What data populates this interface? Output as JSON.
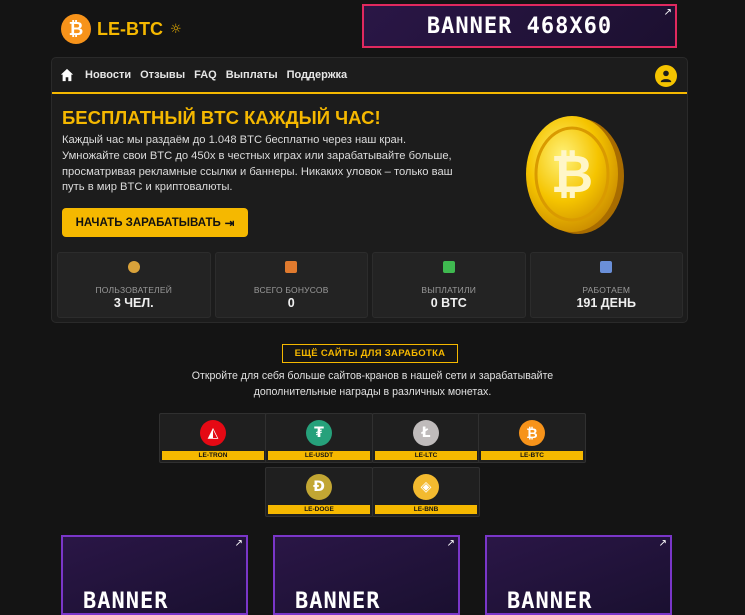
{
  "logo": {
    "text": "LE-BTC",
    "coin_symbol": "₿",
    "sun_glyph": "☼"
  },
  "banner_top": {
    "text": "BANNER 468X60",
    "ext_icon": "↗"
  },
  "nav": {
    "items": [
      "Новости",
      "Отзывы",
      "FAQ",
      "Выплаты",
      "Поддержка"
    ]
  },
  "hero": {
    "title": "БЕСПЛАТНЫЙ BTC КАЖДЫЙ ЧАС!",
    "description": "Каждый час мы раздаём до 1.048 BTC бесплатно через наш кран. Умножайте свои BTC до 450x в честных играх или зарабатывайте больше, просматривая рекламные ссылки и баннеры. Никаких уловок – только ваш путь в мир BTC и криптовалюты.",
    "cta_label": "НАЧАТЬ ЗАРАБАТЫВАТЬ",
    "cta_icon": "⇥"
  },
  "stats": [
    {
      "icon": "users-icon",
      "label": "ПОЛЬЗОВАТЕЛЕЙ",
      "value": "3 ЧЕЛ.",
      "color": "#d9a23a"
    },
    {
      "icon": "gift-icon",
      "label": "ВСЕГО БОНУСОВ",
      "value": "0",
      "color": "#e07a2e"
    },
    {
      "icon": "check-icon",
      "label": "ВЫПЛАТИЛИ",
      "value": "0 BTC",
      "color": "#3fb950"
    },
    {
      "icon": "calendar-icon",
      "label": "РАБОТАЕМ",
      "value": "191 ДЕНЬ",
      "color": "#6a8fd8"
    }
  ],
  "more_sites": {
    "title": "ЕЩЁ САЙТЫ ДЛЯ ЗАРАБОТКА",
    "description": "Откройте для себя больше сайтов-кранов в нашей сети и зарабатывайте дополнительные награды в различных монетах."
  },
  "sites": [
    {
      "label": "LE-TRON",
      "glyph": "◭",
      "color": "#e50914"
    },
    {
      "label": "LE-USDT",
      "glyph": "₮",
      "color": "#26a17b"
    },
    {
      "label": "LE-LTC",
      "glyph": "Ł",
      "color": "#bfbbbb"
    },
    {
      "label": "LE-BTC",
      "glyph": "₿",
      "color": "#f7931a"
    },
    {
      "label": "LE-DOGE",
      "glyph": "Ð",
      "color": "#c2a633"
    },
    {
      "label": "LE-BNB",
      "glyph": "◈",
      "color": "#f3ba2f"
    }
  ],
  "banners_bottom": [
    {
      "text": "BANNER",
      "ext_icon": "↗"
    },
    {
      "text": "BANNER",
      "ext_icon": "↗"
    },
    {
      "text": "BANNER",
      "ext_icon": "↗"
    }
  ],
  "colors": {
    "accent": "#f5b800",
    "background": "#141414",
    "card": "#1c1c1c",
    "banner_border": "#e0295f",
    "banner_border_bottom": "#7a36c9"
  }
}
